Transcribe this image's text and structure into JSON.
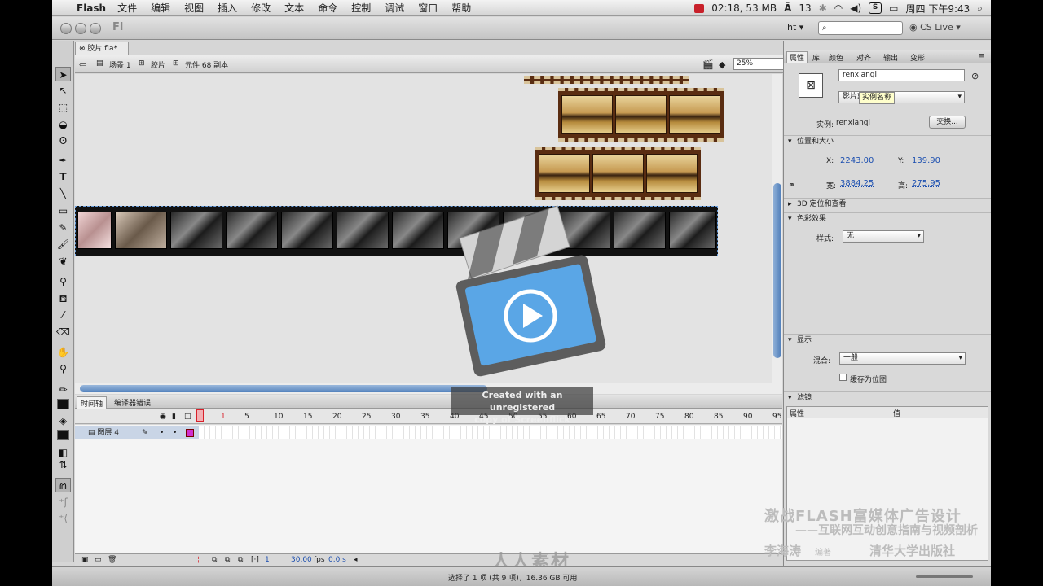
{
  "menubar": {
    "app_name": "Flash",
    "items": [
      "文件",
      "编辑",
      "视图",
      "插入",
      "修改",
      "文本",
      "命令",
      "控制",
      "调试",
      "窗口",
      "帮助"
    ],
    "recording_status": "02:18, 53 MB",
    "adobe_badge": "13",
    "skype_badge": "S",
    "clock": "周四 下午9:43"
  },
  "appbar": {
    "logo": "Fl",
    "workspace": "ht ▾",
    "search_placeholder": "",
    "cs_live": "CS Live"
  },
  "document": {
    "tab_name": "胶片.fla*",
    "breadcrumb": [
      "场景 1",
      "胶片",
      "元件 68 副本"
    ],
    "zoom": "25%"
  },
  "timeline": {
    "tabs": [
      "时间轴",
      "编译器错误"
    ],
    "ruler": [
      "5",
      "10",
      "15",
      "20",
      "25",
      "30",
      "35",
      "40",
      "45",
      "50",
      "55",
      "60",
      "65",
      "70",
      "75",
      "80",
      "85",
      "90",
      "95"
    ],
    "playhead_frame": "1",
    "layer_name": "图层 4",
    "footer": {
      "frame": "1",
      "fps": "30.00",
      "fps_unit": "fps",
      "time": "0.0 s"
    }
  },
  "properties": {
    "tabs": [
      "属性",
      "库",
      "颜色",
      "对齐",
      "输出",
      "变形"
    ],
    "instance_name_value": "renxianqi",
    "symbol_type": "影片剪辑",
    "tooltip": "实例名称",
    "instance_label": "实例:",
    "instance_value": "renxianqi",
    "swap_button": "交换...",
    "pos_section": "位置和大小",
    "x_label": "X:",
    "x_value": "2243.00",
    "y_label": "Y:",
    "y_value": "139.90",
    "w_label": "宽:",
    "w_value": "3884.25",
    "h_label": "高:",
    "h_value": "275.95",
    "section_3d": "3D 定位和查看",
    "color_section": "色彩效果",
    "style_label": "样式:",
    "style_value": "无",
    "display_section": "显示",
    "blend_label": "混合:",
    "blend_value": "一般",
    "cache_label": "缓存为位图",
    "filter_section": "滤镜",
    "filter_col_property": "属性",
    "filter_col_value": "值"
  },
  "overlay": {
    "watermark_line1": "Created with an unregistered",
    "watermark_line2": "copy of Screenflick",
    "promo_title": "激战FLASH富媒体广告设计",
    "promo_subtitle": "——互联网互动创意指南与视频剖析",
    "promo_author": "李海涛",
    "promo_role": "编著",
    "promo_publisher": "清华大学出版社",
    "site_logo": "人人素材"
  },
  "statusbar": {
    "text": "选择了 1 项 (共 9 项)，16.36 GB 可用"
  }
}
